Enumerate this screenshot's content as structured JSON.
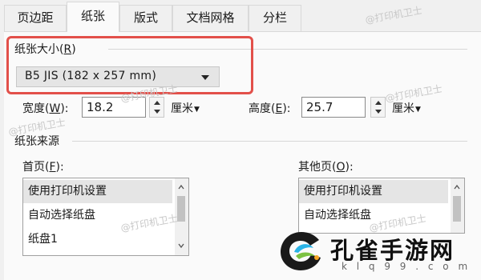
{
  "tabs": [
    {
      "label": "页边距"
    },
    {
      "label": "纸张"
    },
    {
      "label": "版式"
    },
    {
      "label": "文档网格"
    },
    {
      "label": "分栏"
    }
  ],
  "paper_size": {
    "label": "纸张大小(",
    "hotkey": "R",
    "label_end": ")",
    "selected": "B5 JIS (182 x 257 mm)"
  },
  "width": {
    "label": "宽度(",
    "hotkey": "W",
    "label_end": "):",
    "value": "18.2",
    "unit": "厘米"
  },
  "height": {
    "label": "高度(",
    "hotkey": "E",
    "label_end": "):",
    "value": "25.7",
    "unit": "厘米"
  },
  "paper_source": {
    "label": "纸张来源",
    "first_page": {
      "label": "首页(",
      "hotkey": "F",
      "label_end": "):"
    },
    "other_pages": {
      "label": "其他页(",
      "hotkey": "O",
      "label_end": "):"
    },
    "first_page_items": [
      "使用打印机设置",
      "自动选择纸盘",
      "纸盘1"
    ],
    "other_page_items": [
      "使用打印机设置",
      "自动选择纸盘"
    ]
  },
  "watermark": "@打印机卫士",
  "logo": {
    "name": "孔雀手游网",
    "domain": "k l q 9 9 . c o m"
  },
  "colors": {
    "highlight": "#e2504a",
    "selection": "#e5e5e5"
  }
}
